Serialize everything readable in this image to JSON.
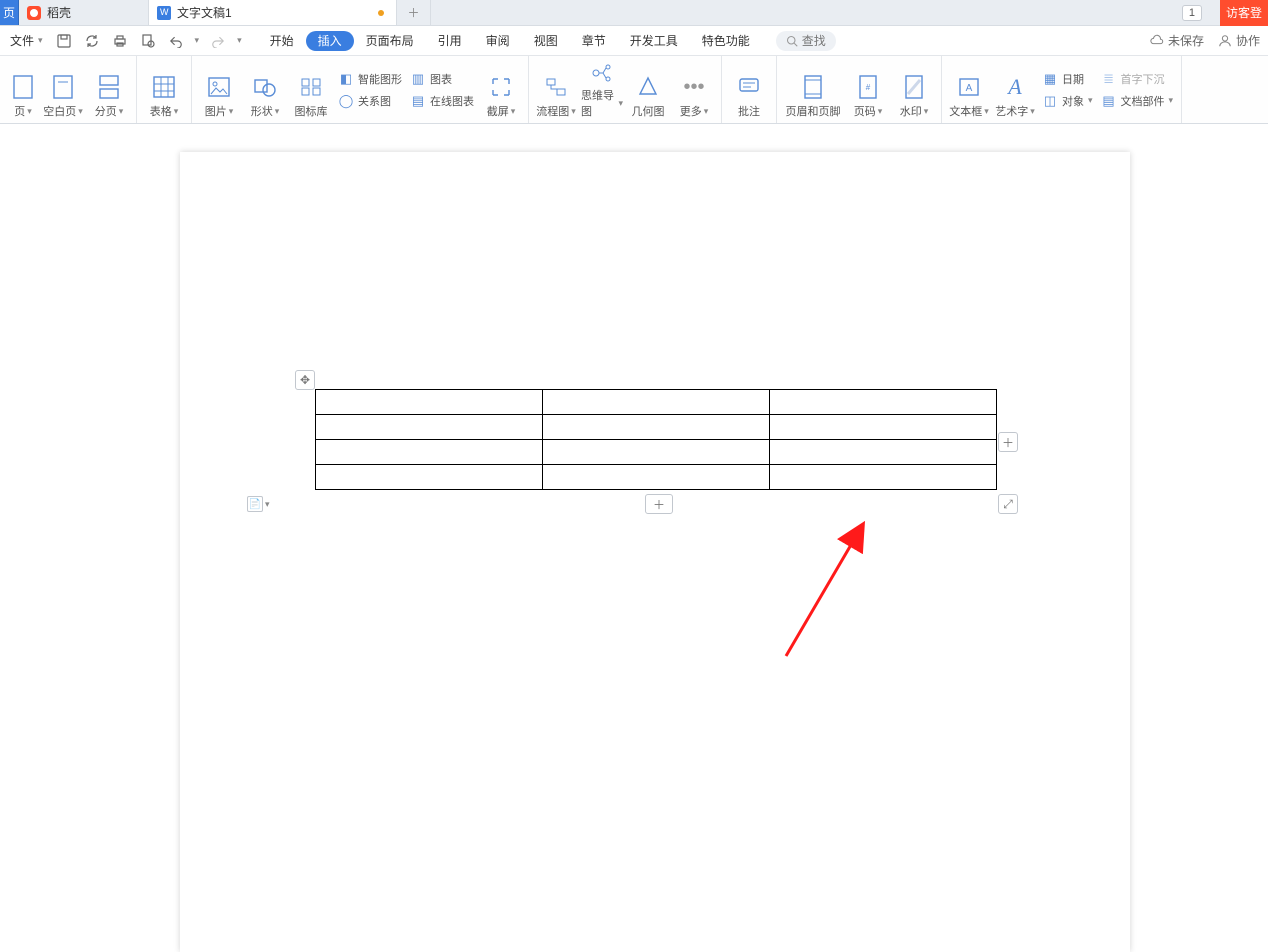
{
  "titlebar": {
    "home_tab": "页",
    "docer_tab": "稻壳",
    "doc_tab": "文字文稿1",
    "page_indicator": "1",
    "login": "访客登"
  },
  "menubar": {
    "file": "文件",
    "tabs": [
      "开始",
      "插入",
      "页面布局",
      "引用",
      "审阅",
      "视图",
      "章节",
      "开发工具",
      "特色功能"
    ],
    "active_index": 1,
    "search_placeholder": "查找",
    "unsaved": "未保存",
    "collab": "协作"
  },
  "ribbon": {
    "g1": {
      "page": "页",
      "blank": "空白页",
      "break": "分页"
    },
    "g2": {
      "table": "表格"
    },
    "g3": {
      "image": "图片",
      "shape": "形状",
      "iconlib": "图标库",
      "smartart": "智能图形",
      "relation": "关系图",
      "chart": "图表",
      "onlinechart": "在线图表"
    },
    "g4": {
      "screenshot": "截屏"
    },
    "g5": {
      "flowchart": "流程图",
      "mindmap": "思维导图",
      "geometry": "几何图",
      "more": "更多"
    },
    "g6": {
      "comment": "批注"
    },
    "g7": {
      "headerfooter": "页眉和页脚",
      "pagenum": "页码",
      "watermark": "水印"
    },
    "g8": {
      "textbox": "文本框",
      "wordart": "艺术字",
      "object": "对象",
      "docparts": "文档部件",
      "date": "日期",
      "dropcap": "首字下沉"
    }
  },
  "table": {
    "rows": 4,
    "cols": 3
  }
}
